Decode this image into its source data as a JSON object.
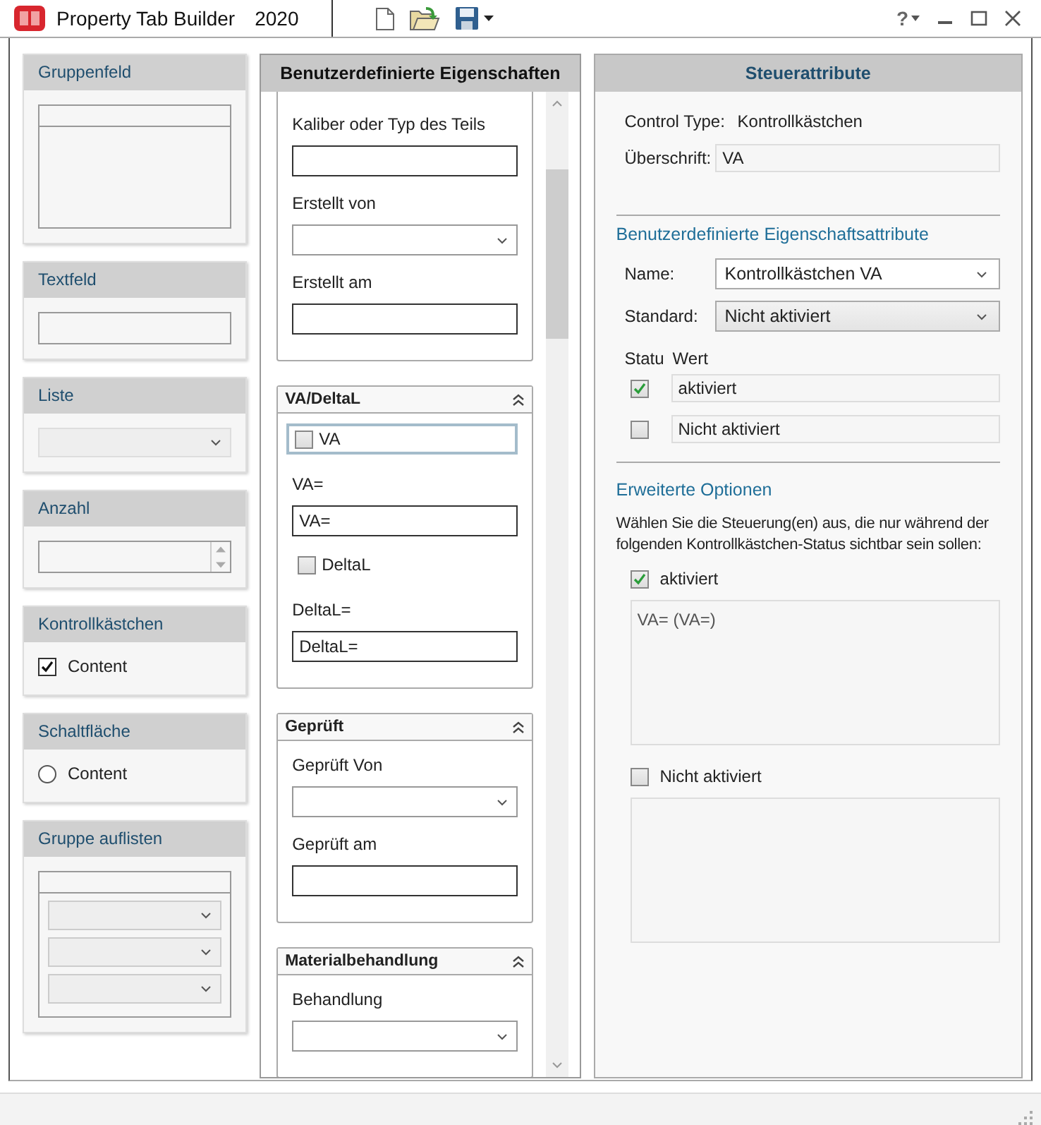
{
  "window": {
    "title": "Property Tab Builder",
    "version": "2020",
    "help": "?"
  },
  "palette": [
    {
      "label": "Gruppenfeld",
      "kind": "group"
    },
    {
      "label": "Textfeld",
      "kind": "textbox"
    },
    {
      "label": "Liste",
      "kind": "list"
    },
    {
      "label": "Anzahl",
      "kind": "number"
    },
    {
      "label": "Kontrollkästchen",
      "kind": "checkbox",
      "content": "Content",
      "checked": true
    },
    {
      "label": "Schaltfläche",
      "kind": "radio",
      "content": "Content",
      "selected": false
    },
    {
      "label": "Gruppe auflisten",
      "kind": "listgroup"
    }
  ],
  "custom_properties": {
    "title": "Benutzerdefinierte Eigenschaften",
    "groups": [
      {
        "controls": [
          {
            "kind": "text",
            "label": "Kaliber oder Typ des Teils"
          },
          {
            "kind": "combo",
            "label": "Erstellt von"
          },
          {
            "kind": "text",
            "label": "Erstellt am"
          }
        ]
      },
      {
        "title": "VA/DeltaL",
        "controls": [
          {
            "kind": "checkbox",
            "label": "VA",
            "checked": false,
            "selected": true
          },
          {
            "kind": "text",
            "label": "VA=",
            "value": "VA="
          },
          {
            "kind": "checkbox",
            "label": "DeltaL",
            "checked": false,
            "selected": false
          },
          {
            "kind": "text",
            "label": "DeltaL=",
            "value": "DeltaL="
          }
        ]
      },
      {
        "title": "Geprüft",
        "controls": [
          {
            "kind": "combo",
            "label": "Geprüft Von"
          },
          {
            "kind": "text",
            "label": "Geprüft am"
          }
        ]
      },
      {
        "title": "Materialbehandlung",
        "controls": [
          {
            "kind": "combo",
            "label": "Behandlung"
          }
        ]
      }
    ]
  },
  "control_attributes": {
    "title": "Steuerattribute",
    "control_type_label": "Control Type:",
    "control_type": "Kontrollkästchen",
    "caption_label": "Überschrift:",
    "caption": "VA",
    "custom_section": {
      "title": "Benutzerdefinierte Eigenschaftsattribute",
      "name_label": "Name:",
      "name": "Kontrollkästchen VA",
      "default_label": "Standard:",
      "default": "Nicht aktiviert",
      "status_header": "Statu",
      "value_header": "Wert",
      "states": [
        {
          "checked": true,
          "value": "aktiviert"
        },
        {
          "checked": false,
          "value": "Nicht aktiviert"
        }
      ]
    },
    "advanced": {
      "title": "Erweiterte Optionen",
      "description": "Wählen Sie die Steuerung(en) aus, die nur während der folgenden Kontrollkästchen-Status sichtbar sein sollen:",
      "states": [
        {
          "label": "aktiviert",
          "checked": true,
          "items": [
            "VA= (VA=)"
          ]
        },
        {
          "label": "Nicht aktiviert",
          "checked": false
        }
      ]
    }
  }
}
